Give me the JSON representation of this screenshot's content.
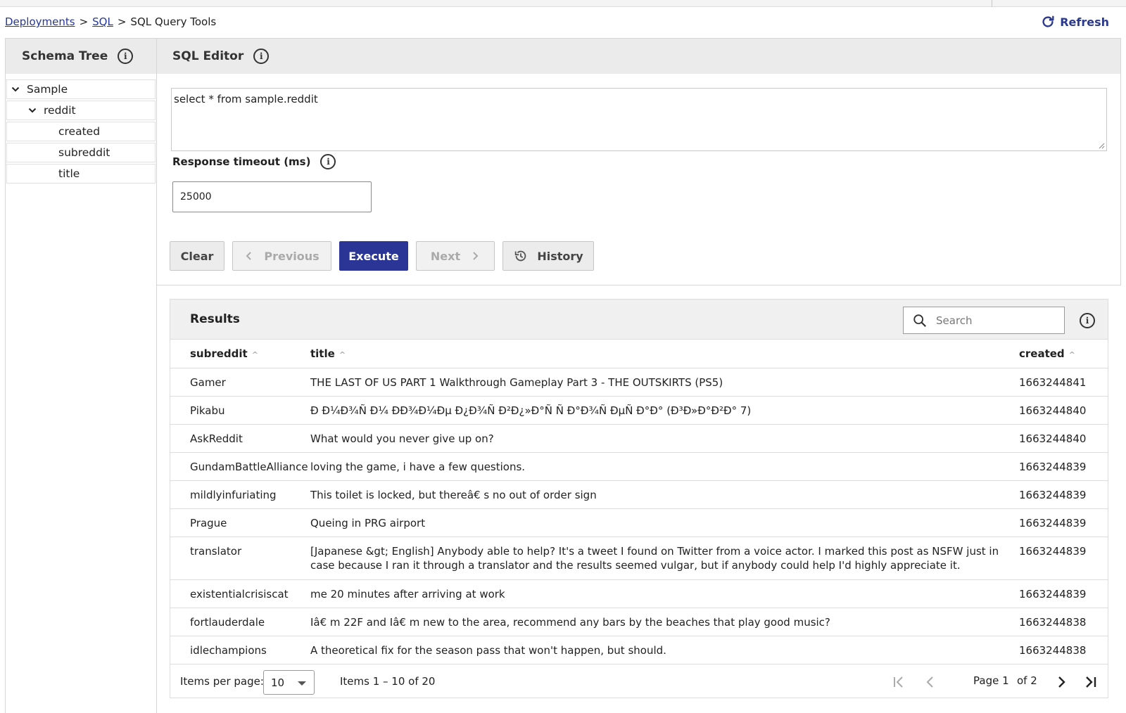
{
  "breadcrumb": {
    "items": [
      "Deployments",
      "SQL",
      "SQL Query Tools"
    ],
    "separator": ">"
  },
  "refresh_label": "Refresh",
  "schema_tree": {
    "title": "Schema Tree",
    "nodes": [
      {
        "label": "Sample",
        "expanded": true,
        "level": 0
      },
      {
        "label": "reddit",
        "expanded": true,
        "level": 1
      },
      {
        "label": "created",
        "level": 2
      },
      {
        "label": "subreddit",
        "level": 2
      },
      {
        "label": "title",
        "level": 2
      }
    ]
  },
  "editor": {
    "title": "SQL Editor",
    "query": "select * from sample.reddit",
    "timeout_label": "Response timeout (ms)",
    "timeout_value": "25000",
    "buttons": {
      "clear": "Clear",
      "previous": "Previous",
      "execute": "Execute",
      "next": "Next",
      "history": "History"
    }
  },
  "results": {
    "title": "Results",
    "search_placeholder": "Search",
    "columns": [
      "subreddit",
      "title",
      "created"
    ],
    "rows": [
      {
        "subreddit": "Gamer",
        "title": "THE LAST OF US PART 1 Walkthrough Gameplay Part 3 - THE OUTSKIRTS (PS5)",
        "created": "1663244841"
      },
      {
        "subreddit": "Pikabu",
        "title": "Ð  Ð¼Ð¾Ñ  Ð¼ ÐÐ¾Ð¼Ðµ Ð¿Ð¾Ñ  Ð²Ð¿»Ð°Ñ  Ñ   Ð°Ð¾Ñ  ÐµÑ  Ð°Ð° (Ð³Ð»Ð°Ð²Ð° 7)",
        "created": "1663244840"
      },
      {
        "subreddit": "AskReddit",
        "title": "What would you never give up on?",
        "created": "1663244840"
      },
      {
        "subreddit": "GundamBattleAlliance",
        "title": "loving the game, i have a few questions.",
        "created": "1663244839"
      },
      {
        "subreddit": "mildlyinfuriating",
        "title": "This toilet is locked, but thereâ€  s no out of order sign",
        "created": "1663244839"
      },
      {
        "subreddit": "Prague",
        "title": "Queing in PRG airport",
        "created": "1663244839"
      },
      {
        "subreddit": "translator",
        "title": "[Japanese &gt; English] Anybody able to help? It's a tweet I found on Twitter from a voice actor. I marked this post as NSFW just in case because I ran it through a translator and the results seemed vulgar, but if anybody could help I'd highly appreciate it.",
        "created": "1663244839"
      },
      {
        "subreddit": "existentialcrisiscat",
        "title": "me 20 minutes after arriving at work",
        "created": "1663244839"
      },
      {
        "subreddit": "fortlauderdale",
        "title": "Iâ€  m 22F and Iâ€  m new to the area, recommend any bars by the beaches that play good music?",
        "created": "1663244838"
      },
      {
        "subreddit": "idlechampions",
        "title": "A theoretical fix for the season pass that won't happen, but should.",
        "created": "1663244838"
      }
    ],
    "pager": {
      "items_per_page_label": "Items per page:",
      "items_per_page": "10",
      "range": "Items 1 – 10 of 20",
      "page_label": "Page 1",
      "of_label": "of 2"
    }
  }
}
